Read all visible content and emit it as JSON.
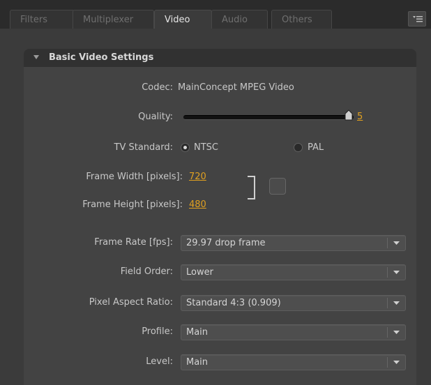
{
  "tabs": [
    {
      "label": "Filters"
    },
    {
      "label": "Multiplexer"
    },
    {
      "label": "Video"
    },
    {
      "label": "Audio"
    },
    {
      "label": "Others"
    }
  ],
  "active_tab": "Video",
  "panel": {
    "title": "Basic Video Settings",
    "codec": {
      "label": "Codec:",
      "value": "MainConcept MPEG Video"
    },
    "quality": {
      "label": "Quality:",
      "value": "5",
      "level": 1.0
    },
    "tv_standard": {
      "label": "TV Standard:",
      "options": [
        "NTSC",
        "PAL"
      ],
      "selected": "NTSC"
    },
    "frame_width": {
      "label": "Frame Width [pixels]:",
      "value": "720"
    },
    "frame_height": {
      "label": "Frame Height [pixels]:",
      "value": "480"
    },
    "frame_rate": {
      "label": "Frame Rate [fps]:",
      "value": "29.97 drop frame"
    },
    "field_order": {
      "label": "Field Order:",
      "value": "Lower"
    },
    "pixel_aspect": {
      "label": "Pixel Aspect Ratio:",
      "value": "Standard 4:3 (0.909)"
    },
    "profile": {
      "label": "Profile:",
      "value": "Main"
    },
    "level": {
      "label": "Level:",
      "value": "Main"
    }
  },
  "colors": {
    "accent": "#e0a020",
    "background": "#3b3b3b",
    "panel": "#434343",
    "header": "#313131"
  },
  "icons": [
    "panel-menu-icon",
    "collapse-triangle-icon",
    "slider-thumb-icon",
    "chevron-down-icon"
  ]
}
